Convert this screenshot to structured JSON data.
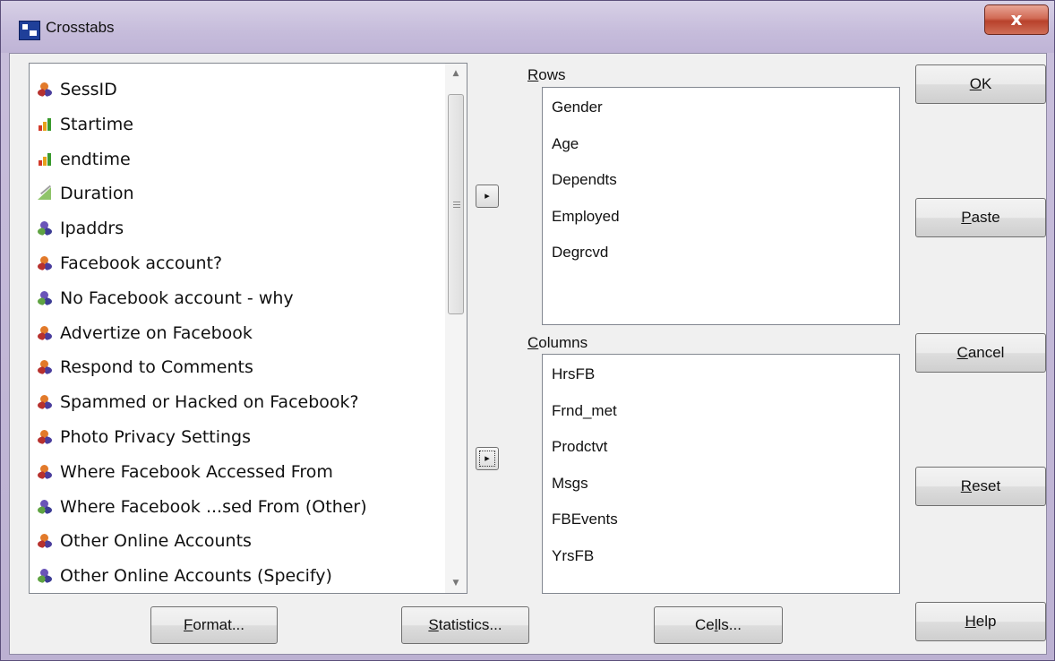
{
  "window": {
    "title": "Crosstabs",
    "close_glyph": "x"
  },
  "variables": [
    {
      "label": "SessID",
      "icon": "nominal-icon"
    },
    {
      "label": "Startime",
      "icon": "ordinal-icon"
    },
    {
      "label": "endtime",
      "icon": "ordinal-icon"
    },
    {
      "label": "Duration",
      "icon": "scale-icon"
    },
    {
      "label": "Ipaddrs",
      "icon": "string-icon"
    },
    {
      "label": "Facebook account?",
      "icon": "nominal-icon"
    },
    {
      "label": "No Facebook account - why",
      "icon": "string-icon"
    },
    {
      "label": "Advertize on Facebook",
      "icon": "nominal-icon"
    },
    {
      "label": "Respond to Comments",
      "icon": "nominal-icon"
    },
    {
      "label": "Spammed or Hacked on Facebook?",
      "icon": "nominal-icon"
    },
    {
      "label": "Photo Privacy Settings",
      "icon": "nominal-icon"
    },
    {
      "label": "Where Facebook Accessed From",
      "icon": "nominal-icon"
    },
    {
      "label": "Where Facebook ...sed From (Other)",
      "icon": "string-icon"
    },
    {
      "label": "Other Online Accounts",
      "icon": "nominal-icon"
    },
    {
      "label": "Other Online Accounts (Specify)",
      "icon": "string-icon"
    }
  ],
  "rows": {
    "label_prefix": "R",
    "label_rest": "ows",
    "items": [
      "Gender",
      "Age",
      "Dependts",
      "Employed",
      "Degrcvd"
    ]
  },
  "columns": {
    "label_prefix": "C",
    "label_rest": "olumns",
    "items": [
      "HrsFB",
      "Frnd_met",
      "Prodctvt",
      "Msgs",
      "FBEvents",
      "YrsFB"
    ]
  },
  "arrow_glyph": "▸",
  "buttons": {
    "ok": {
      "u": "O",
      "rest": "K"
    },
    "paste": {
      "u": "P",
      "rest": "aste"
    },
    "cancel": {
      "u": "C",
      "rest": "ancel"
    },
    "reset": {
      "u": "R",
      "rest": "eset"
    },
    "help": {
      "u": "H",
      "rest": "elp"
    },
    "format": {
      "u": "F",
      "rest": "ormat..."
    },
    "statistics": {
      "u": "S",
      "rest": "tatistics..."
    },
    "cells": {
      "pre": "Ce",
      "u": "l",
      "rest": "ls..."
    }
  }
}
